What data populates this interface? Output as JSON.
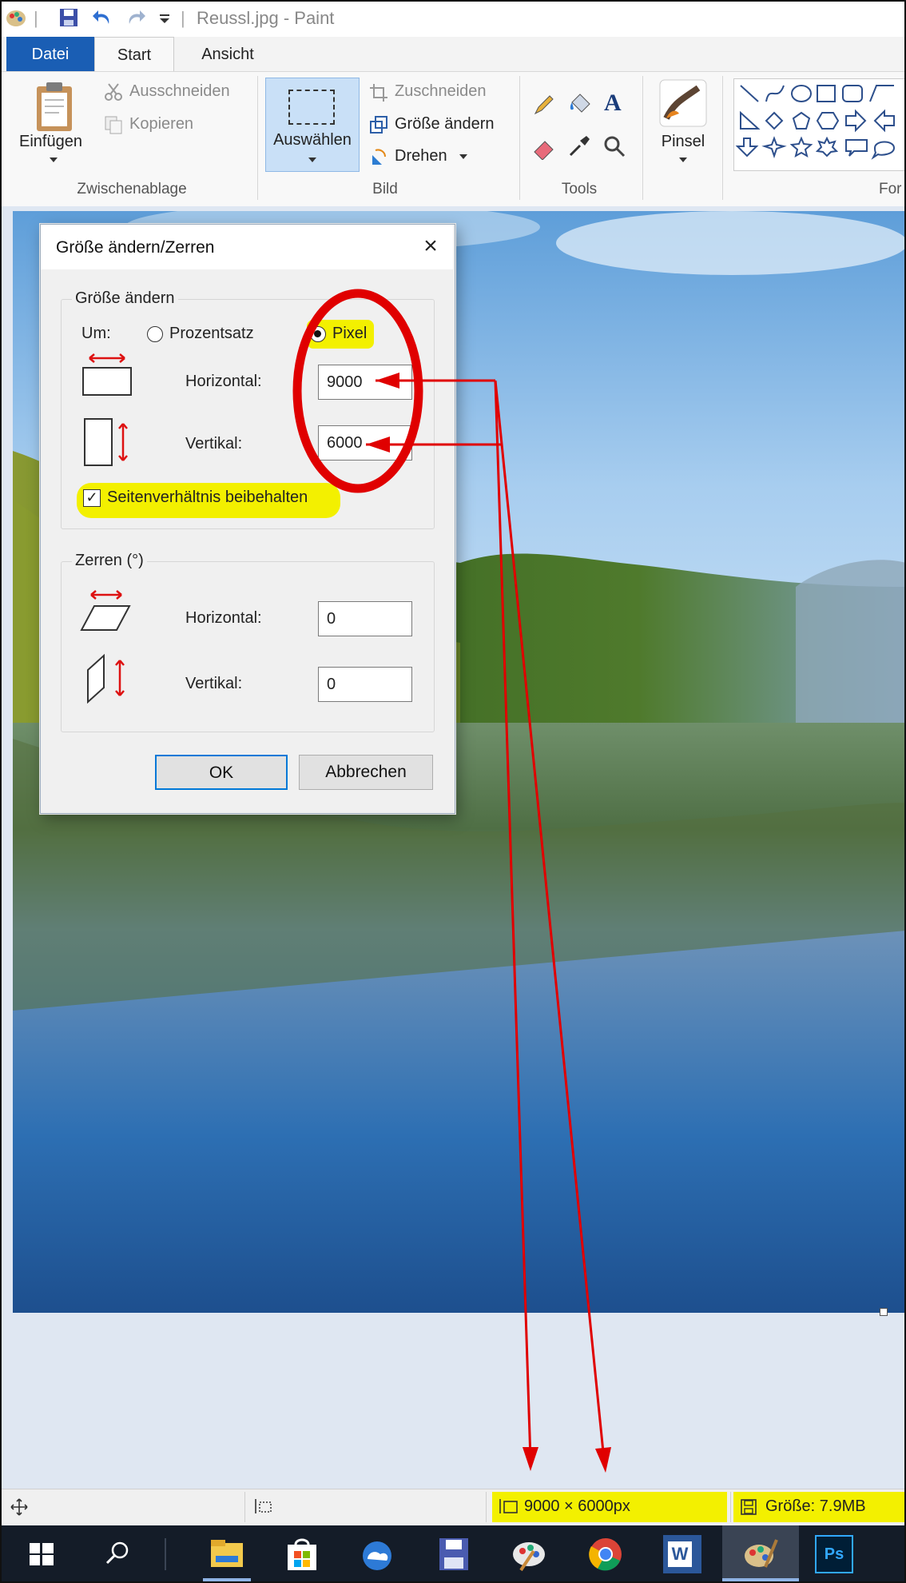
{
  "window": {
    "title": "Reussl.jpg - Paint",
    "separator": "|"
  },
  "ribbon_tabs": [
    "Datei",
    "Start",
    "Ansicht"
  ],
  "ribbon": {
    "clipboard": {
      "paste": "Einfügen",
      "cut": "Ausschneiden",
      "copy": "Kopieren",
      "label": "Zwischenablage"
    },
    "image": {
      "select": "Auswählen",
      "crop": "Zuschneiden",
      "resize": "Größe ändern",
      "rotate": "Drehen",
      "label": "Bild"
    },
    "tools": {
      "label": "Tools",
      "text_tool": "A"
    },
    "brushes": {
      "label": "Pinsel"
    },
    "shapes": {
      "label": "For"
    }
  },
  "dialog": {
    "title": "Größe ändern/Zerren",
    "resize_section": "Größe ändern",
    "by_label": "Um:",
    "option_percent": "Prozentsatz",
    "option_pixel": "Pixel",
    "selected_option": "Pixel",
    "horizontal_label": "Horizontal:",
    "vertical_label": "Vertikal:",
    "resize_horizontal": "9000",
    "resize_vertical": "6000",
    "keep_aspect": "Seitenverhältnis beibehalten",
    "keep_aspect_checked": true,
    "skew_section": "Zerren (°)",
    "skew_horizontal": "0",
    "skew_vertical": "0",
    "ok": "OK",
    "cancel": "Abbrechen"
  },
  "statusbar": {
    "dimensions": "9000 × 6000px",
    "size": "Größe: 7.9MB"
  },
  "taskbar": {
    "icons": [
      "windows-start",
      "search",
      "file-explorer",
      "store",
      "mail-cloud",
      "save-disk",
      "paint-palette",
      "chrome",
      "word",
      "paint",
      "photoshop"
    ],
    "ps_label": "Ps",
    "word_label": "W"
  },
  "colors": {
    "file_tab": "#1a5eb4",
    "highlight": "#f3f000",
    "annotation": "#e00000",
    "taskbar": "#141c28"
  }
}
